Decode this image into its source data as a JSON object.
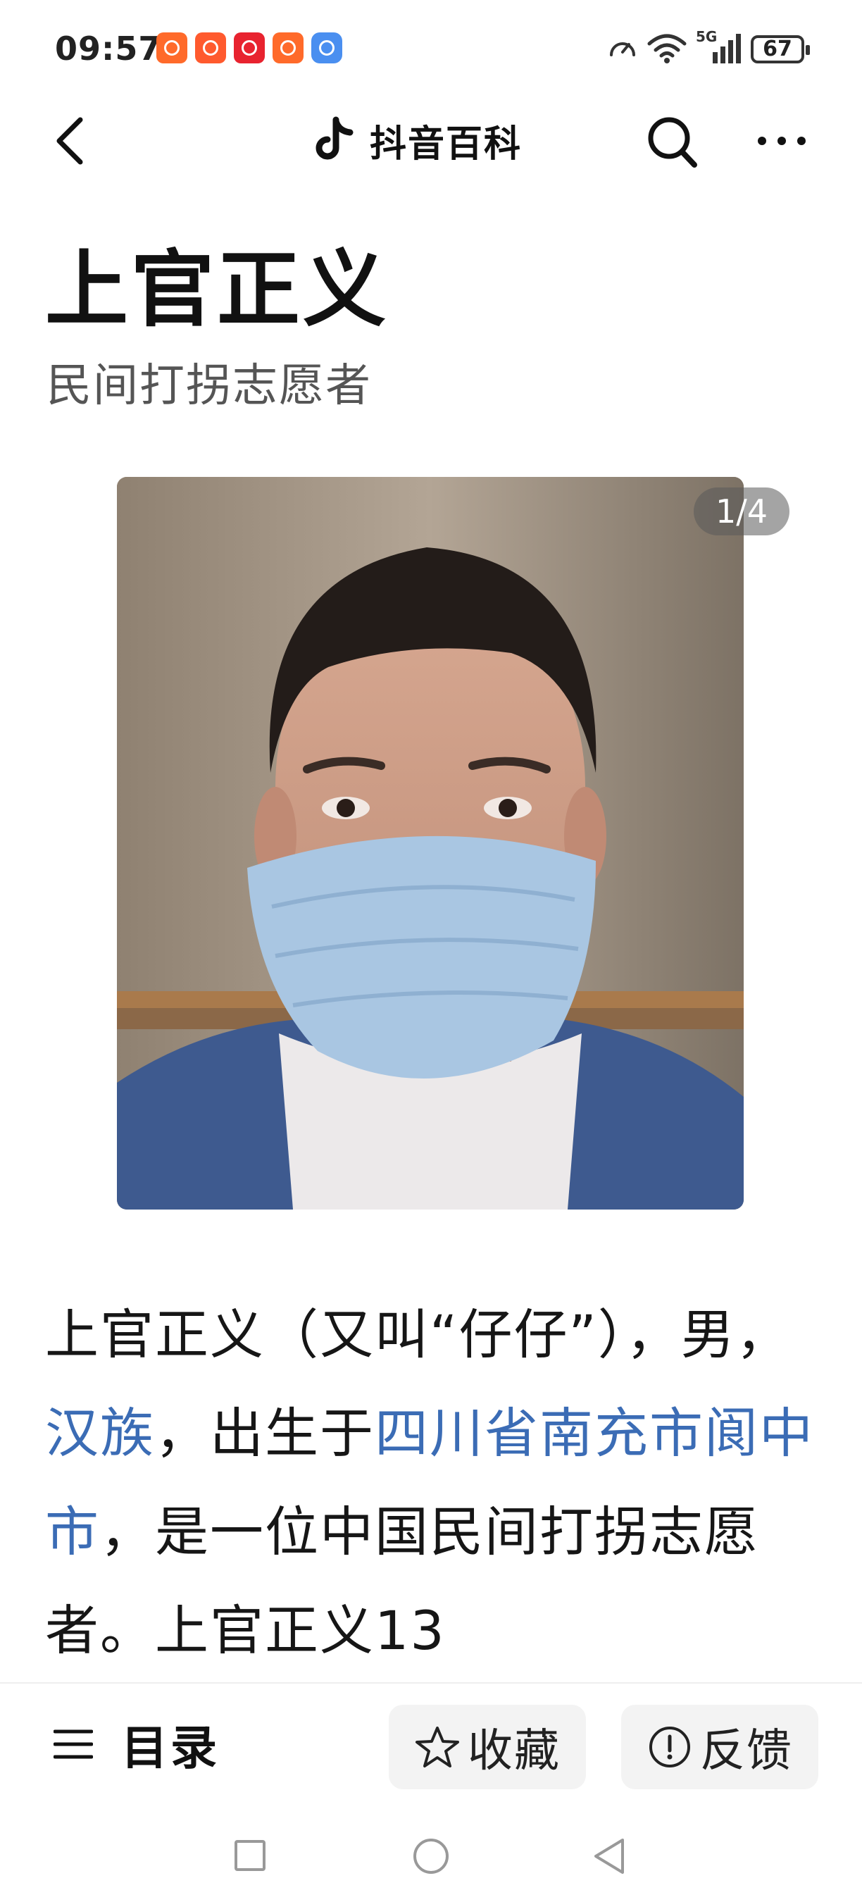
{
  "status_bar": {
    "time": "09:57",
    "network": "5G",
    "battery": "67",
    "icons": [
      "app-notification-icon",
      "app-notification-icon",
      "app-notification-icon",
      "app-notification-icon",
      "message-icon",
      "speed-icon",
      "wifi-icon",
      "signal-icon",
      "battery-icon"
    ]
  },
  "header": {
    "brand": "抖音百科",
    "icons": [
      "back-arrow-icon",
      "douyin-logo-icon",
      "search-icon",
      "more-icon"
    ]
  },
  "article": {
    "title": "上官正义",
    "subtitle": "民间打拐志愿者",
    "photo_counter": "1/4",
    "intro": {
      "s1": "上官正义（又叫“仔仔”），男，",
      "link1": "汉族",
      "s2": "，出生于",
      "link2": "四川省南充市阆中市",
      "s3": "，是一位中国民间打拐志愿者。上官正义13"
    }
  },
  "toolbar": {
    "toc_label": "目录",
    "favorite_label": "收藏",
    "feedback_label": "反馈"
  },
  "colors": {
    "link": "#3b6cb5",
    "subtitle": "#555555",
    "pill_bg": "#f3f3f3"
  }
}
